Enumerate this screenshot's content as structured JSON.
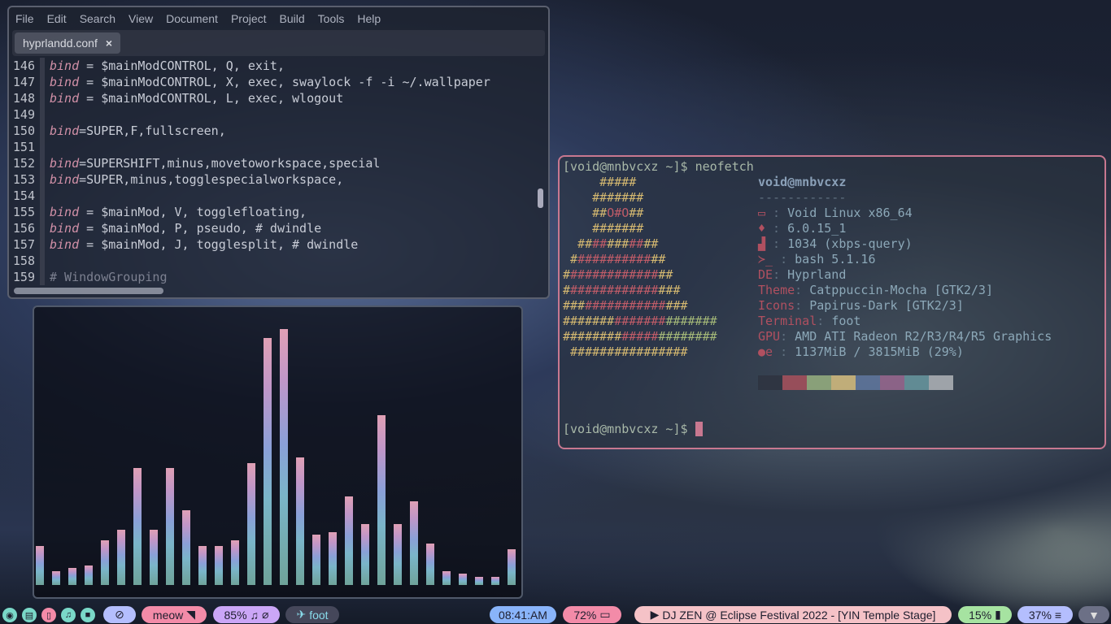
{
  "editor": {
    "menu": [
      "File",
      "Edit",
      "Search",
      "View",
      "Document",
      "Project",
      "Build",
      "Tools",
      "Help"
    ],
    "tab": {
      "label": "hyprlandd.conf",
      "close": "×"
    },
    "lines": [
      {
        "n": "146",
        "kw": "bind",
        "rest": " = $mainModCONTROL, Q, exit,"
      },
      {
        "n": "147",
        "kw": "bind",
        "rest": " = $mainModCONTROL, X, exec, swaylock -f -i ~/.wallpaper"
      },
      {
        "n": "148",
        "kw": "bind",
        "rest": " = $mainModCONTROL, L, exec, wlogout"
      },
      {
        "n": "149",
        "kw": "",
        "rest": ""
      },
      {
        "n": "150",
        "kw": "bind",
        "rest": "=SUPER,F,fullscreen,"
      },
      {
        "n": "151",
        "kw": "",
        "rest": ""
      },
      {
        "n": "152",
        "kw": "bind",
        "rest": "=SUPERSHIFT,minus,movetoworkspace,special"
      },
      {
        "n": "153",
        "kw": "bind",
        "rest": "=SUPER,minus,togglespecialworkspace,"
      },
      {
        "n": "154",
        "kw": "",
        "rest": ""
      },
      {
        "n": "155",
        "kw": "bind",
        "rest": " = $mainMod, V, togglefloating,"
      },
      {
        "n": "156",
        "kw": "bind",
        "rest": " = $mainMod, P, pseudo, # dwindle"
      },
      {
        "n": "157",
        "kw": "bind",
        "rest": " = $mainMod, J, togglesplit, # dwindle"
      },
      {
        "n": "158",
        "kw": "",
        "rest": ""
      },
      {
        "n": "159",
        "kw": "",
        "rest": "",
        "comment": "# WindowGrouping"
      }
    ]
  },
  "visualizer": {
    "levels": [
      0.14,
      0.05,
      0.06,
      0.07,
      0.16,
      0.2,
      0.42,
      0.2,
      0.42,
      0.27,
      0.14,
      0.14,
      0.16,
      0.44,
      0.89,
      0.92,
      0.46,
      0.18,
      0.19,
      0.32,
      0.22,
      0.61,
      0.22,
      0.3,
      0.15,
      0.05,
      0.04,
      0.03,
      0.03,
      0.13
    ]
  },
  "terminal": {
    "prompt": "[void@mnbvcxz ~]$ ",
    "command": "neofetch",
    "art": [
      [
        "     ",
        "#####"
      ],
      [
        "    ",
        "#######"
      ],
      [
        "    ",
        "##",
        "O#O",
        "##"
      ],
      [
        "    ",
        "#######"
      ],
      [
        "  ",
        "##",
        "##",
        "###",
        "##",
        "##"
      ]
    ],
    "header": "void@mnbvcxz",
    "sep": "------------",
    "info": [
      {
        "icon": "monitor-icon",
        "glyph": "▭",
        "label": "",
        "value": "Void Linux x86_64"
      },
      {
        "icon": "linux-icon",
        "glyph": "♦",
        "label": "",
        "value": "6.0.15_1"
      },
      {
        "icon": "package-icon",
        "glyph": "▟",
        "label": "",
        "value": "1034 (xbps-query)"
      },
      {
        "icon": "shell-icon",
        "glyph": "≻_",
        "label": "",
        "value": "bash 5.1.16"
      },
      {
        "label": "DE",
        "value": "Hyprland"
      },
      {
        "label": "Theme",
        "value": "Catppuccin-Mocha [GTK2/3]"
      },
      {
        "label": "Icons",
        "value": "Papirus-Dark [GTK2/3]"
      },
      {
        "label": "Terminal",
        "value": "foot"
      },
      {
        "label": "GPU",
        "value": "AMD ATI Radeon R2/R3/R4/R5 Graphics"
      },
      {
        "icon": "memory-icon",
        "glyph": "●e",
        "label": "",
        "value": "1137MiB / 3815MiB (29%)"
      }
    ],
    "palette": [
      "#2e3440",
      "#a8505c",
      "#98b080",
      "#d8c080",
      "#6078a0",
      "#9a6890",
      "#6898a0",
      "#b0b4b8"
    ],
    "prompt2": "[void@mnbvcxz ~]$ "
  },
  "taskbar": {
    "launchers": [
      "browser-icon",
      "folder-icon",
      "document-icon",
      "headphones-icon",
      "camera-icon"
    ],
    "network": "meow",
    "audio": "85%",
    "window": "foot",
    "clock": "08:41:AM",
    "battery": "72%",
    "media": "DJ ZEN @ Eclipse Festival 2022 - [YIN Temple Stage]",
    "cpu": "15%",
    "memory": "37%"
  },
  "colors": {
    "pink": "#f38ba8",
    "lavender": "#b4befe",
    "mauve": "#cba6f7",
    "blue": "#89b4fa",
    "green": "#a6e3a1",
    "rose": "#f5c2c7",
    "teal": "#94e2d5"
  }
}
